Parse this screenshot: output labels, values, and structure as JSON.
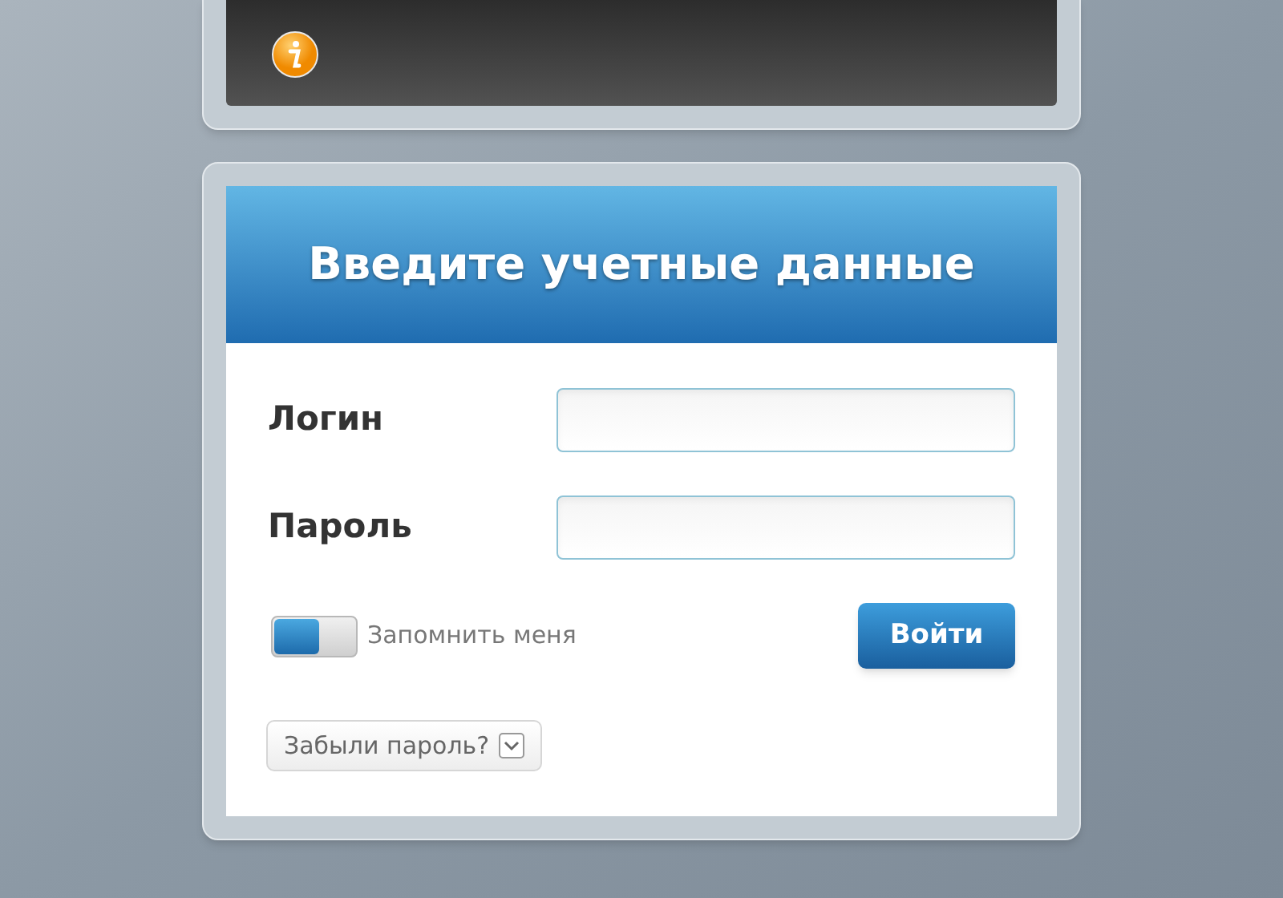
{
  "heading": "Введите учетные данные",
  "fields": [
    {
      "label": "Логин"
    },
    {
      "label": "Пароль"
    }
  ],
  "remember": {
    "label": "Запомнить меня",
    "on": false
  },
  "submit": "Войти",
  "forgot": "Забыли пароль?"
}
